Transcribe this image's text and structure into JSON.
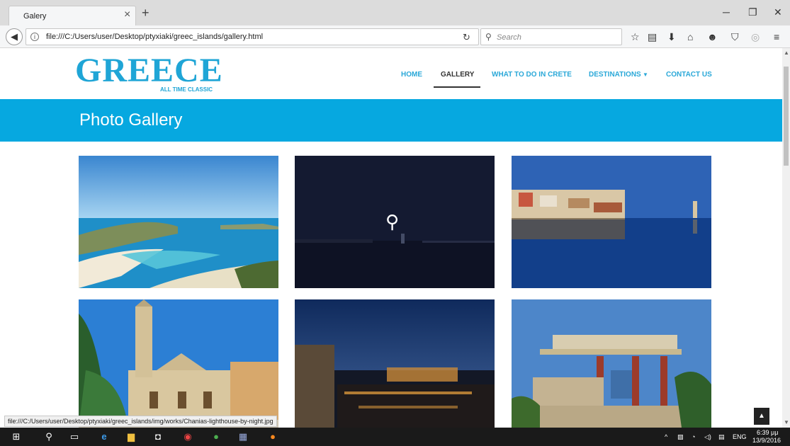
{
  "browser": {
    "tab_title": "Galery",
    "tab_close": "×",
    "new_tab": "+",
    "url": "file:///C:/Users/user/Desktop/ptyxiaki/greec_islands/gallery.html",
    "search_placeholder": "Search",
    "status_url": "file:///C:/Users/user/Desktop/ptyxiaki/greec_islands/img/works/Chanias-lighthouse-by-night.jpg"
  },
  "site": {
    "logo": "GREECE",
    "tagline": "ALL TIME CLASSIC",
    "nav": {
      "home": "HOME",
      "gallery": "GALLERY",
      "what_to_do": "WHAT TO DO IN CRETE",
      "destinations": "DESTINATIONS",
      "contact": "CONTACT US"
    },
    "page_title": "Photo Gallery"
  },
  "taskbar": {
    "lang": "ENG",
    "time": "6:39 μμ",
    "date": "13/9/2016"
  },
  "colors": {
    "accent": "#06a8e0",
    "logo": "#1fa5d6",
    "nav_link": "#2aa8d8"
  }
}
